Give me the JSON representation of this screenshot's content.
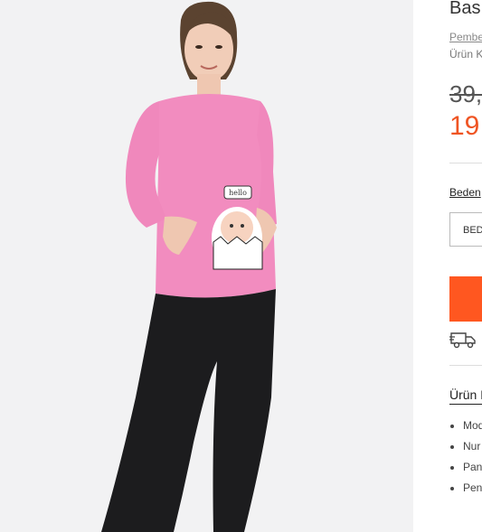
{
  "product": {
    "title": "Bas",
    "color_link": "Pembe",
    "code_label": "Ürün K",
    "old_price": "39,",
    "new_price": "19"
  },
  "size": {
    "guide_label": "Beden",
    "select_value": "BED"
  },
  "details": {
    "title": "Ürün D",
    "bullets": [
      "Mod",
      "Nur",
      "Pan",
      "Pen"
    ]
  },
  "colors": {
    "accent": "#ff5720",
    "sale_price": "#ef5423",
    "shirt": "#f28cbf",
    "leggings": "#1c1c1e"
  },
  "photo": {
    "print_text": "hello"
  }
}
